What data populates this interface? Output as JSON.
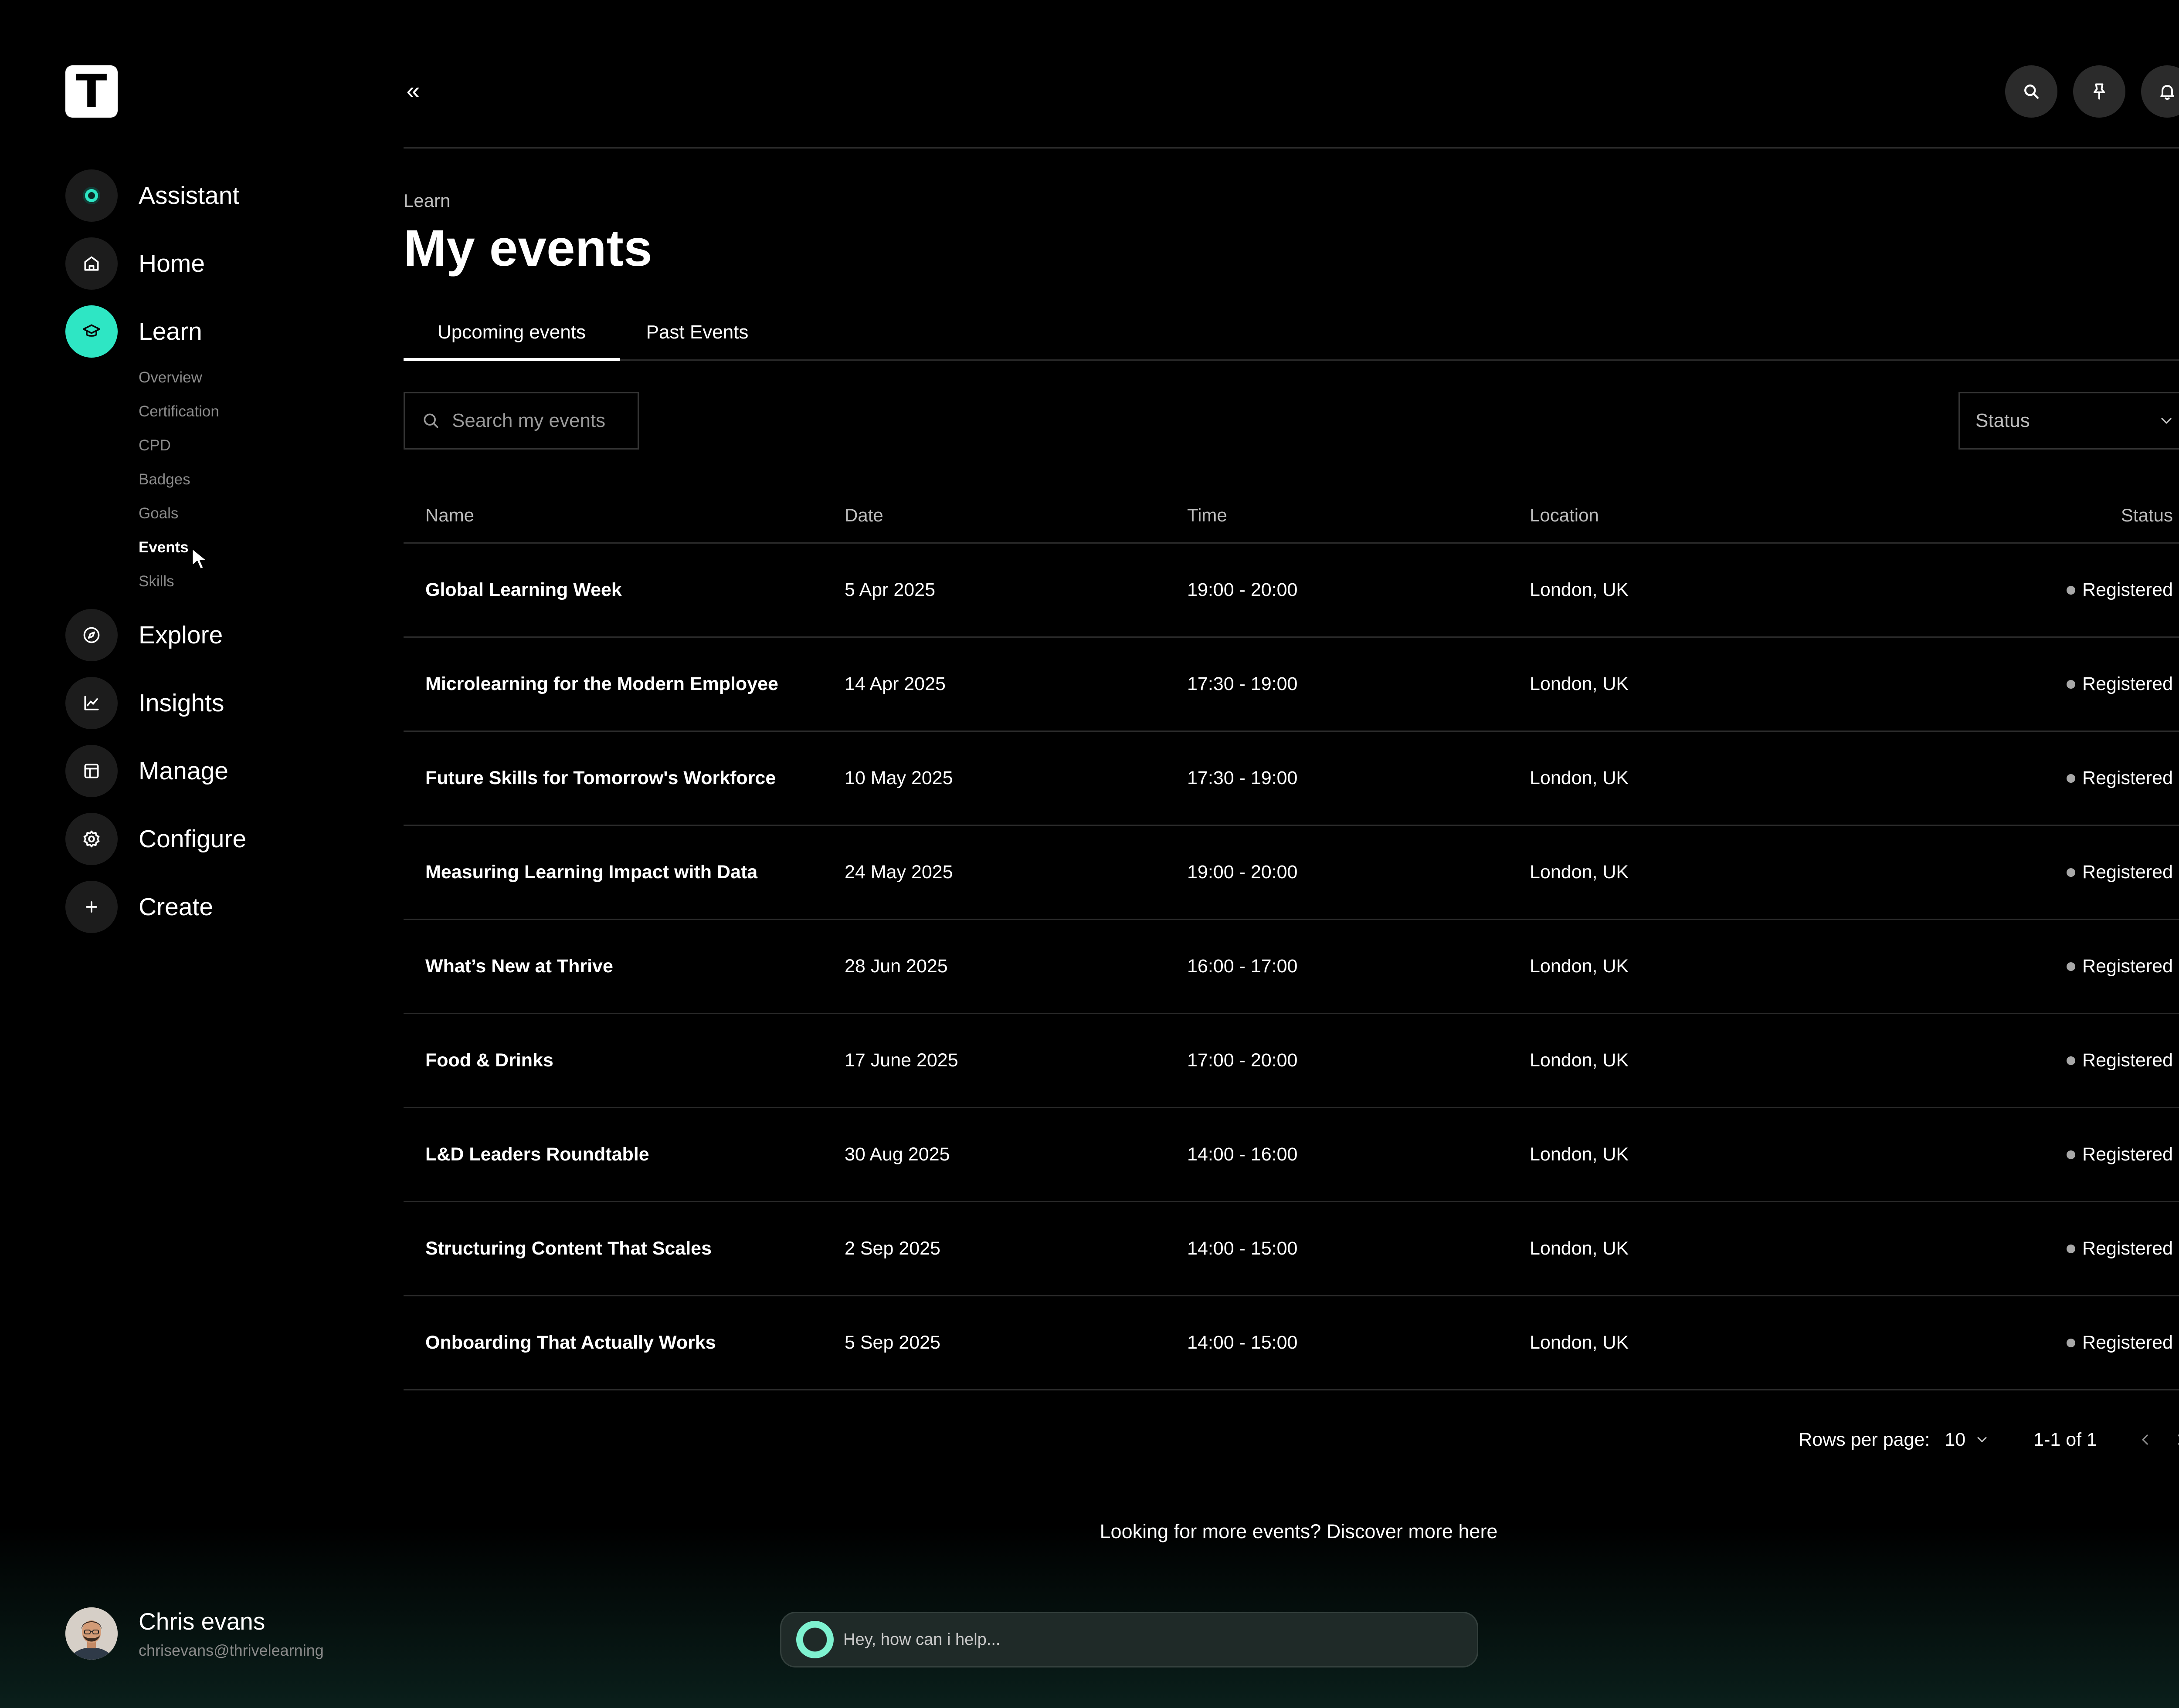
{
  "app": {
    "logo_letter": "T",
    "accent_color": "#2ee6c4"
  },
  "sidebar": {
    "items": [
      {
        "label": "Assistant",
        "icon": "assistant-orb-icon"
      },
      {
        "label": "Home",
        "icon": "home-icon"
      },
      {
        "label": "Learn",
        "icon": "graduation-cap-icon",
        "active": true
      },
      {
        "label": "Explore",
        "icon": "compass-icon"
      },
      {
        "label": "Insights",
        "icon": "line-chart-icon"
      },
      {
        "label": "Manage",
        "icon": "layout-icon"
      },
      {
        "label": "Configure",
        "icon": "gear-icon"
      },
      {
        "label": "Create",
        "icon": "plus-icon"
      }
    ],
    "learn_subitems": [
      "Overview",
      "Certification",
      "CPD",
      "Badges",
      "Goals",
      "Events",
      "Skills"
    ],
    "active_subitem": "Events"
  },
  "user": {
    "name": "Chris evans",
    "email": "chrisevans@thrivelearning"
  },
  "header": {
    "collapse_glyph": "«",
    "buttons": [
      "search-icon",
      "pin-icon",
      "bell-icon"
    ]
  },
  "page": {
    "breadcrumb": "Learn",
    "title": "My events"
  },
  "tabs": [
    {
      "label": "Upcoming events",
      "active": true
    },
    {
      "label": "Past Events",
      "active": false
    }
  ],
  "toolbar": {
    "search_placeholder": "Search my events",
    "status_filter_label": "Status"
  },
  "table": {
    "columns": [
      "Name",
      "Date",
      "Time",
      "Location",
      "Status"
    ],
    "rows": [
      [
        "Global Learning Week",
        "5 Apr 2025",
        "19:00 - 20:00",
        "London, UK",
        "Registered"
      ],
      [
        "Microlearning for the Modern Employee",
        "14 Apr 2025",
        "17:30 - 19:00",
        "London, UK",
        "Registered"
      ],
      [
        "Future Skills for Tomorrow's Workforce",
        "10 May 2025",
        "17:30 - 19:00",
        "London, UK",
        "Registered"
      ],
      [
        "Measuring Learning Impact with Data",
        "24 May 2025",
        "19:00 - 20:00",
        "London, UK",
        "Registered"
      ],
      [
        "What’s New at Thrive",
        "28 Jun 2025",
        "16:00 - 17:00",
        "London, UK",
        "Registered"
      ],
      [
        "Food & Drinks",
        "17 June 2025",
        "17:00 - 20:00",
        "London, UK",
        "Registered"
      ],
      [
        "L&D Leaders Roundtable",
        "30 Aug 2025",
        "14:00 - 16:00",
        "London, UK",
        "Registered"
      ],
      [
        "Structuring Content That Scales",
        "2 Sep 2025",
        "14:00 - 15:00",
        "London, UK",
        "Registered"
      ],
      [
        "Onboarding That Actually Works",
        "5 Sep 2025",
        "14:00 - 15:00",
        "London, UK",
        "Registered"
      ]
    ]
  },
  "pagination": {
    "rows_per_page_label": "Rows per page:",
    "rows_per_page_value": "10",
    "range_text": "1-1 of 1"
  },
  "discover_text": "Looking for more events? Discover more here",
  "assistant_bar": {
    "placeholder": "Hey, how can i help..."
  }
}
